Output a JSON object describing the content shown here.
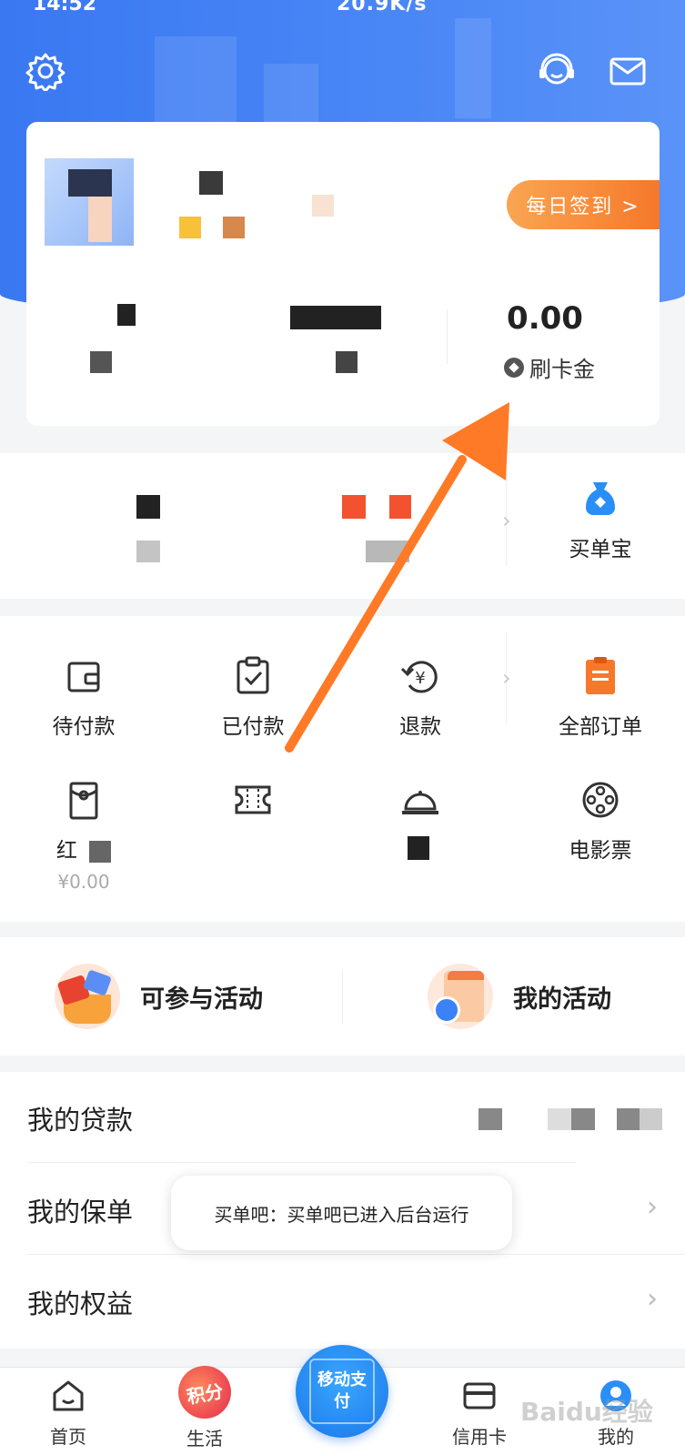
{
  "status_bar": {
    "time": "14:52",
    "right": "20.9K/s"
  },
  "colors": {
    "primary_blue": "#3a78f2",
    "accent_orange": "#f6782a",
    "arrow_orange": "#ff7a26"
  },
  "top_icons": {
    "settings": "gear-icon",
    "service": "headset-icon",
    "messages": "mail-icon"
  },
  "card": {
    "signin_label": "每日签到 >",
    "card_cash_value": "0.00",
    "card_cash_label": "刷卡金"
  },
  "wallet": {
    "maidanbao_label": "买单宝"
  },
  "orders": {
    "row1": [
      {
        "label": "待付款",
        "icon": "wallet-icon"
      },
      {
        "label": "已付款",
        "icon": "clipboard-check-icon"
      },
      {
        "label": "退款",
        "icon": "refund-icon"
      },
      {
        "label": "全部订单",
        "icon": "orders-icon"
      }
    ],
    "row2": [
      {
        "label": "红",
        "sub": "¥0.00",
        "icon": "redpacket-icon"
      },
      {
        "label": "",
        "icon": "coupon-icon"
      },
      {
        "label": "",
        "icon": "dining-icon"
      },
      {
        "label": "电影票",
        "icon": "film-icon"
      }
    ]
  },
  "activities": {
    "available": "可参与活动",
    "mine": "我的活动"
  },
  "rows": [
    {
      "label": "我的贷款"
    },
    {
      "label": "我的保单"
    },
    {
      "label": "我的权益"
    }
  ],
  "toast": "买单吧：买单吧已进入后台运行",
  "tabs": {
    "home": "首页",
    "life": "生活",
    "life_badge": "积分",
    "pay": "移动支付",
    "credit": "信用卡",
    "mine": "我的"
  },
  "watermark": "Baidu经验"
}
